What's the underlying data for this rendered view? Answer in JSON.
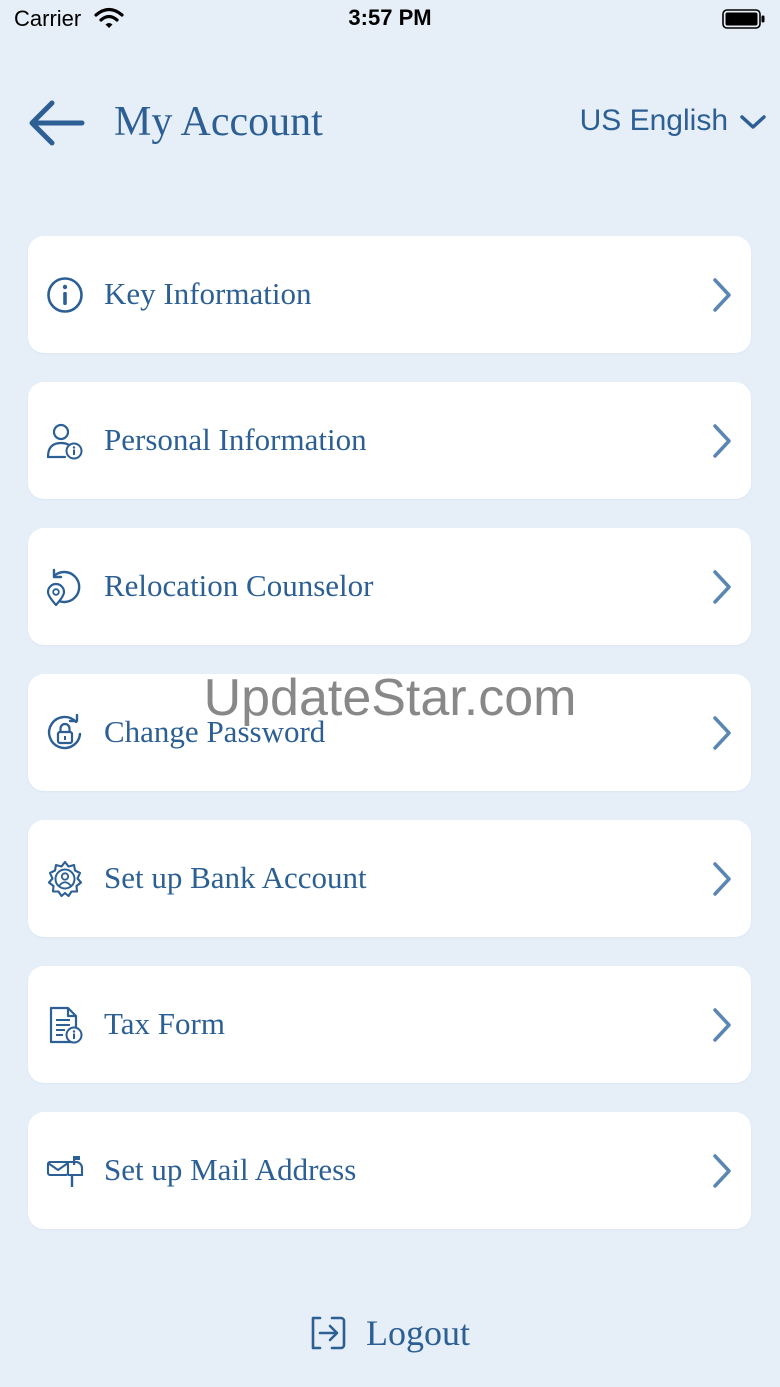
{
  "status_bar": {
    "carrier": "Carrier",
    "time": "3:57 PM"
  },
  "header": {
    "title": "My Account",
    "language": "US English"
  },
  "menu": {
    "items": [
      {
        "label": "Key Information",
        "icon": "info-icon"
      },
      {
        "label": "Personal Information",
        "icon": "user-info-icon"
      },
      {
        "label": "Relocation Counselor",
        "icon": "relocation-pin-icon"
      },
      {
        "label": "Change Password",
        "icon": "lock-refresh-icon"
      },
      {
        "label": "Set up Bank Account",
        "icon": "gear-user-icon"
      },
      {
        "label": "Tax Form",
        "icon": "document-icon"
      },
      {
        "label": "Set up Mail Address",
        "icon": "mailbox-icon"
      }
    ]
  },
  "logout": {
    "label": "Logout"
  },
  "watermark": "UpdateStar.com",
  "colors": {
    "accent": "#2c5f94",
    "background": "#e6eef8",
    "card": "#ffffff",
    "chevron": "#5a86b4"
  }
}
